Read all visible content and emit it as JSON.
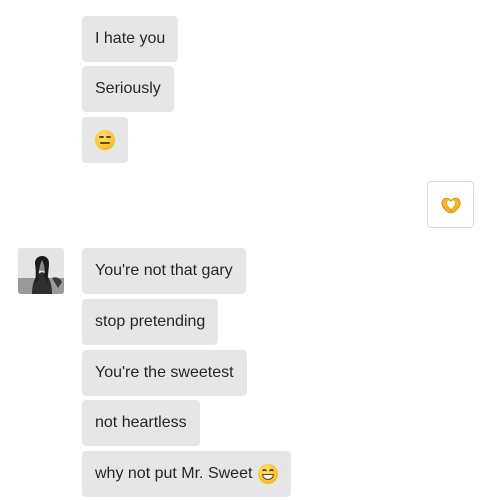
{
  "conversation": {
    "received_top": [
      {
        "text": "I hate you"
      },
      {
        "text": "Seriously"
      },
      {
        "text": "",
        "emoji": "expressionless-face-emoji"
      }
    ],
    "sent": [
      {
        "emoji": "heart-hands-emoji"
      }
    ],
    "received_bottom": [
      {
        "text": "You're not that gary"
      },
      {
        "text": "stop pretending"
      },
      {
        "text": "You're the sweetest"
      },
      {
        "text": "not heartless"
      },
      {
        "text": "why not put Mr. Sweet",
        "emoji": "grinning-face-emoji"
      }
    ]
  },
  "colors": {
    "received_bubble": "#e6e6e6",
    "sent_bubble_border": "#dbdbdb",
    "text": "#262626",
    "emoji_yellow": "#f7c52b"
  },
  "avatar": {
    "icon": "contact-avatar-photo"
  }
}
